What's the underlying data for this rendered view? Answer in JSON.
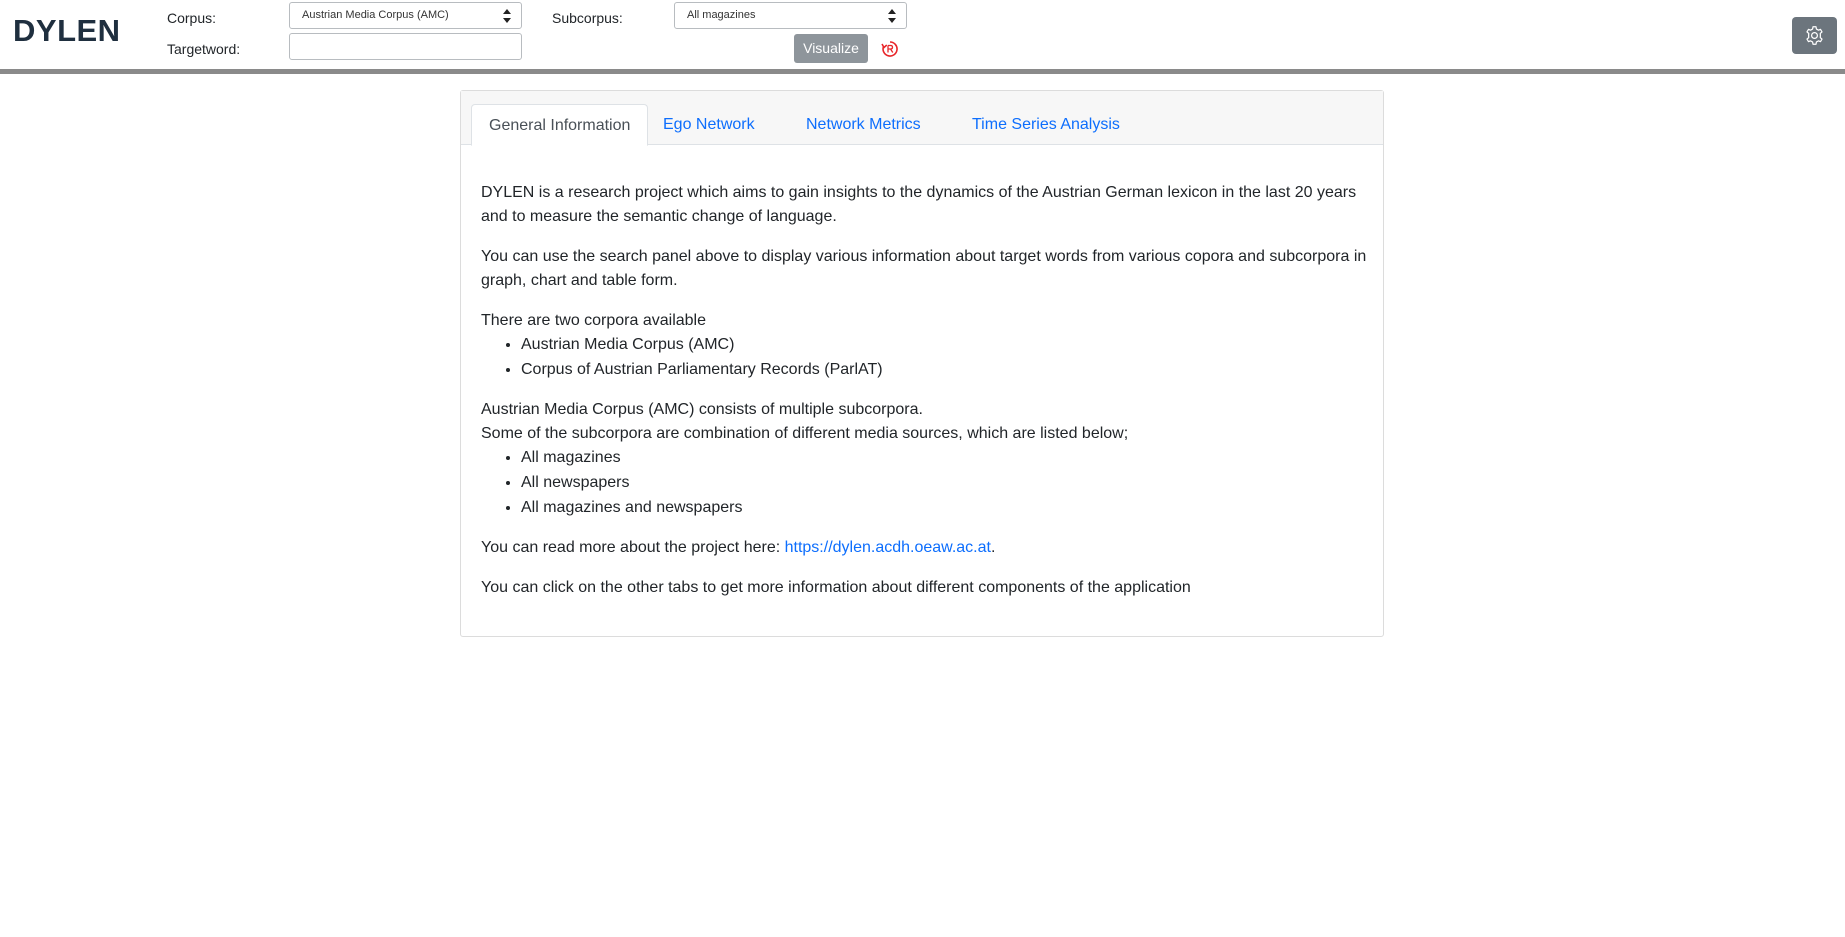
{
  "app": {
    "logo": "DYLEN"
  },
  "search": {
    "corpus_label": "Corpus:",
    "corpus_value": "Austrian Media Corpus (AMC)",
    "subcorpus_label": "Subcorpus:",
    "subcorpus_value": "All magazines",
    "targetword_label": "Targetword:",
    "targetword_value": "",
    "visualize_label": "Visualize"
  },
  "colors": {
    "accent_link": "#0d6efd",
    "button_disabled": "#8e959b",
    "reset_icon": "#e8262a",
    "settings_button": "#6c757d"
  },
  "icons": {
    "reset": "reset-icon",
    "settings": "gear-icon"
  },
  "tabs": [
    {
      "label": "General Information",
      "active": true
    },
    {
      "label": "Ego Network",
      "active": false
    },
    {
      "label": "Network Metrics",
      "active": false
    },
    {
      "label": "Time Series Analysis",
      "active": false
    }
  ],
  "content": {
    "intro": "DYLEN is a research project which aims to gain insights to the dynamics of the Austrian German lexicon in the last 20 years and to measure the semantic change of language.",
    "usage": "You can use the search panel above to display various information about target words from various copora and subcorpora in graph, chart and table form.",
    "corpora_heading": "There are two corpora available",
    "corpora": [
      "Austrian Media Corpus (AMC)",
      "Corpus of Austrian Parliamentary Records (ParlAT)"
    ],
    "amc_line1": "Austrian Media Corpus (AMC) consists of multiple subcorpora.",
    "amc_line2": "Some of the subcorpora are combination of different media sources, which are listed below;",
    "subcorpora": [
      "All magazines",
      "All newspapers",
      "All magazines and newspapers"
    ],
    "read_more_prefix": "You can read more about the project here: ",
    "read_more_link": "https://dylen.acdh.oeaw.ac.at",
    "read_more_suffix": ".",
    "tabs_hint": "You can click on the other tabs to get more information about different components of the application"
  }
}
